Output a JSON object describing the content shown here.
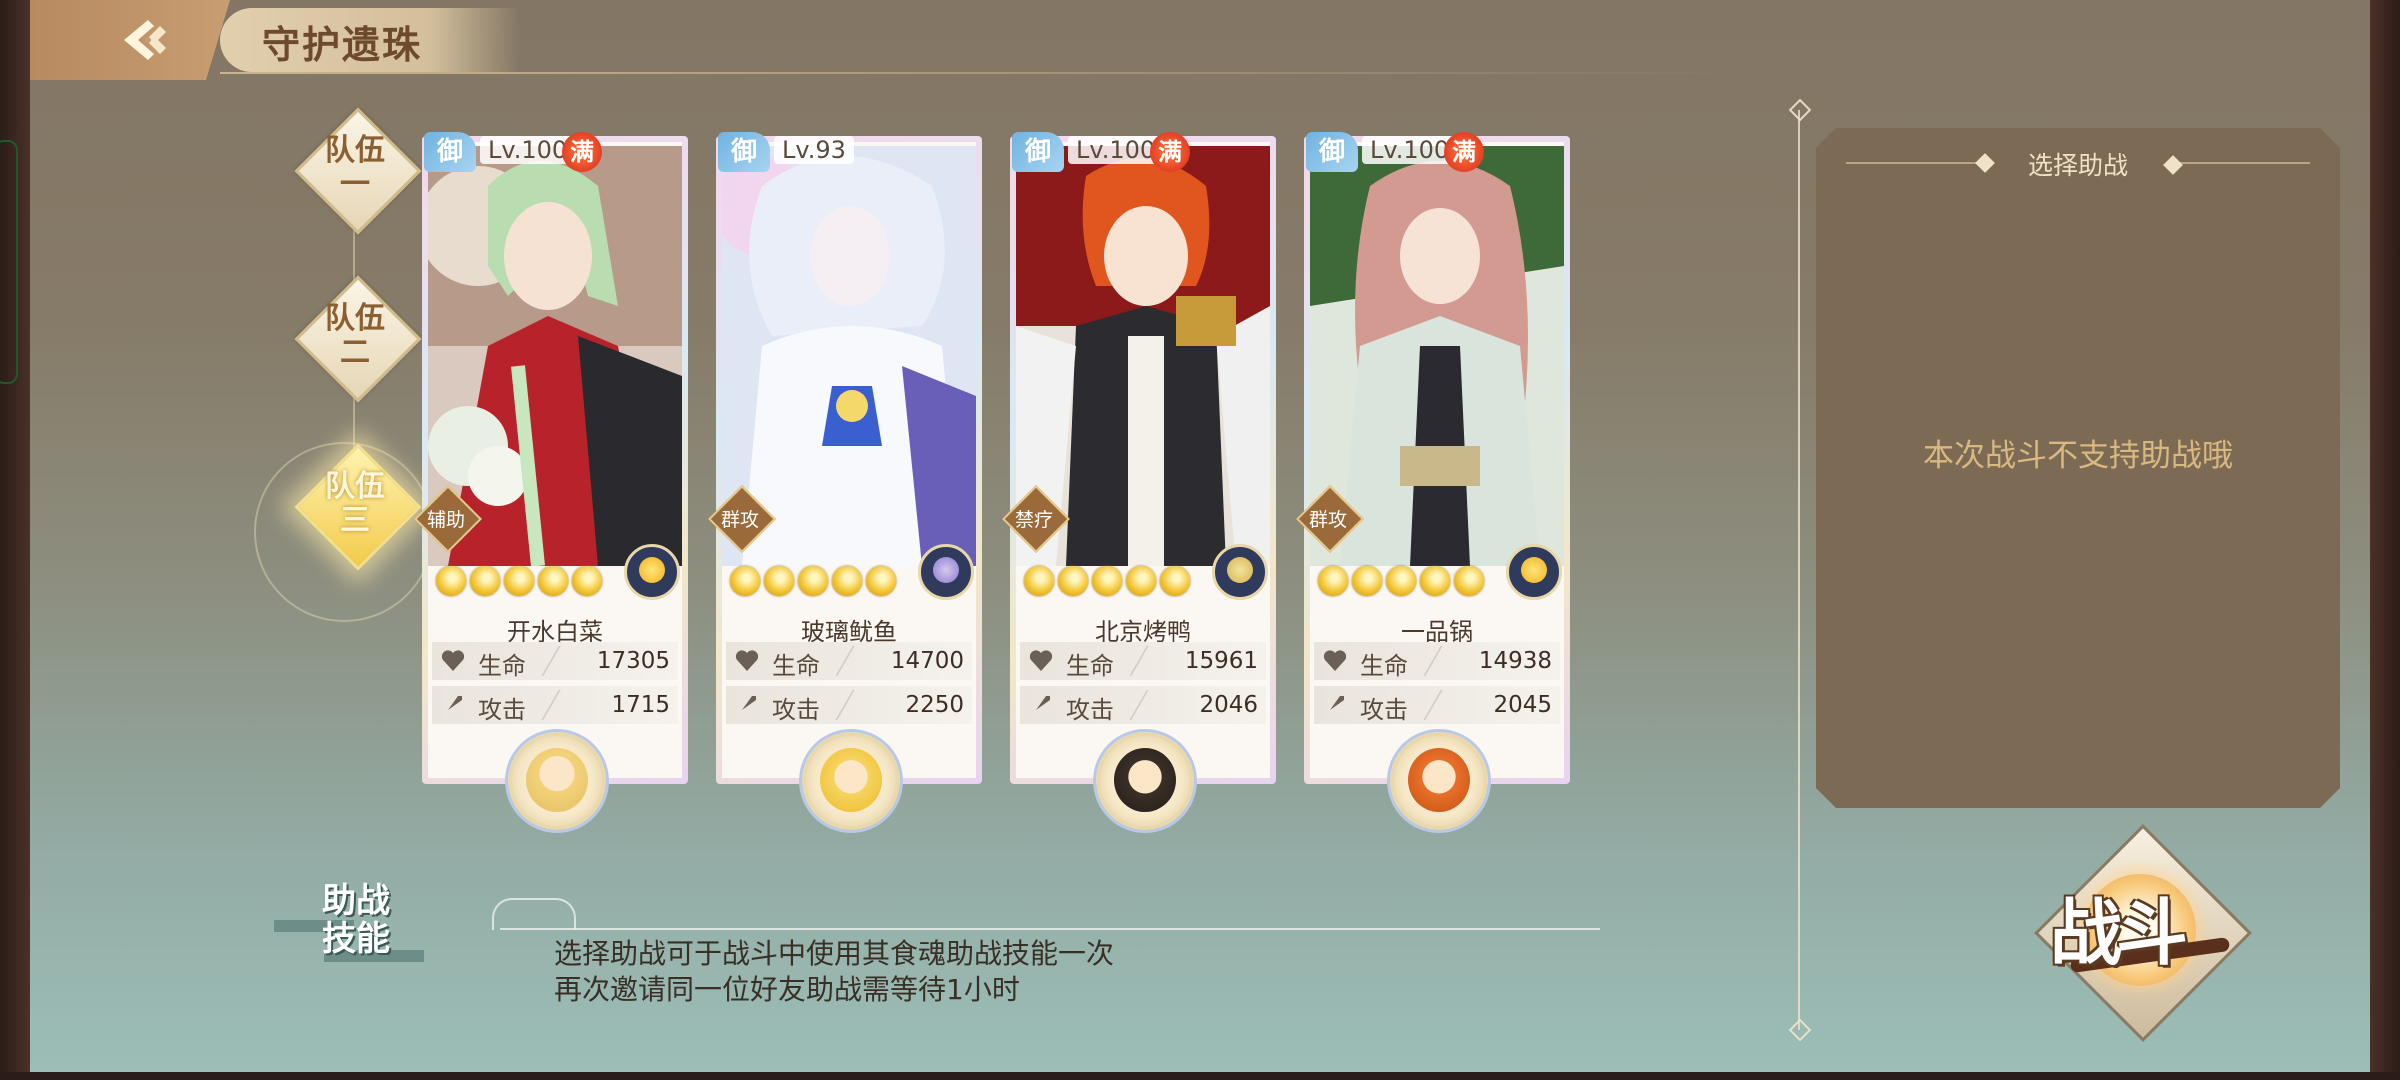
{
  "header": {
    "title": "守护遗珠",
    "back_icon": "back-arrow-icon"
  },
  "teams": [
    {
      "label": "队伍\n一",
      "active": false
    },
    {
      "label": "队伍\n二",
      "active": false
    },
    {
      "label": "队伍\n三",
      "active": true
    }
  ],
  "cards": [
    {
      "tag": "御",
      "level": "Lv.100",
      "full": "满",
      "role": "辅助",
      "name": "开水白菜",
      "hp_label": "生命",
      "hp": "17305",
      "atk_label": "攻击",
      "atk": "1715",
      "stars": 5
    },
    {
      "tag": "御",
      "level": "Lv.93",
      "full": "",
      "role": "群攻",
      "name": "玻璃鱿鱼",
      "hp_label": "生命",
      "hp": "14700",
      "atk_label": "攻击",
      "atk": "2250",
      "stars": 5
    },
    {
      "tag": "御",
      "level": "Lv.100",
      "full": "满",
      "role": "禁疗",
      "name": "北京烤鸭",
      "hp_label": "生命",
      "hp": "15961",
      "atk_label": "攻击",
      "atk": "2046",
      "stars": 5
    },
    {
      "tag": "御",
      "level": "Lv.100",
      "full": "满",
      "role": "群攻",
      "name": "一品锅",
      "hp_label": "生命",
      "hp": "14938",
      "atk_label": "攻击",
      "atk": "2045",
      "stars": 5
    }
  ],
  "assist_panel": {
    "title": "选择助战",
    "message": "本次战斗不支持助战哦"
  },
  "assist_skill": {
    "badge": "助战\n技能",
    "line1": "选择助战可于战斗中使用其食魂助战技能一次",
    "line2": "再次邀请同一位好友助战需等待1小时"
  },
  "fight_button": {
    "label": "战斗"
  },
  "colors": {
    "panel": "#7c6a55",
    "panel_text": "#d9b980",
    "accent_gold": "#f3c531"
  }
}
